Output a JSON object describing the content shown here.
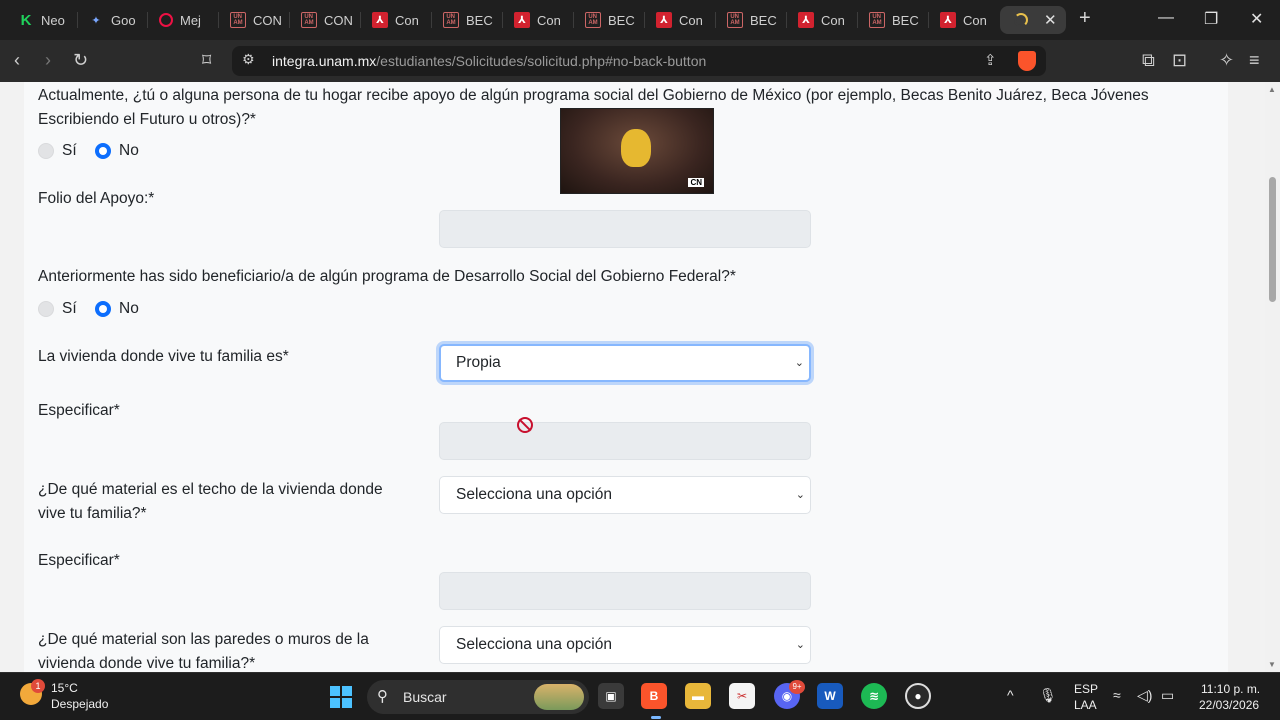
{
  "browser": {
    "tabs": [
      {
        "label": "Neo",
        "icon": "k-icon"
      },
      {
        "label": "Goo",
        "icon": "gemini-icon"
      },
      {
        "label": "Mej",
        "icon": "record-icon"
      },
      {
        "label": "CON",
        "icon": "unam-icon"
      },
      {
        "label": "CON",
        "icon": "unam-icon"
      },
      {
        "label": "Con",
        "icon": "pdf-icon"
      },
      {
        "label": "BEC",
        "icon": "unam-icon"
      },
      {
        "label": "Con",
        "icon": "pdf-icon"
      },
      {
        "label": "BEC",
        "icon": "unam-icon"
      },
      {
        "label": "Con",
        "icon": "pdf-icon"
      },
      {
        "label": "BEC",
        "icon": "unam-icon"
      },
      {
        "label": "Con",
        "icon": "pdf-icon"
      },
      {
        "label": "BEC",
        "icon": "unam-icon"
      },
      {
        "label": "Con",
        "icon": "pdf-icon"
      }
    ],
    "url_host": "integra.unam.mx",
    "url_path": "/estudiantes/Solicitudes/solicitud.php#no-back-button",
    "close_glyph": "✕",
    "new_tab_glyph": "+"
  },
  "form": {
    "q_apoyo": "Actualmente, ¿tú o alguna persona de tu hogar recibe apoyo de algún programa social del Gobierno de México (por ejemplo, Becas Benito Juárez, Beca Jóvenes Escribiendo el Futuro u otros)?*",
    "yes_label": "Sí",
    "no_label": "No",
    "folio_label": "Folio del Apoyo:*",
    "q_beneficiario": "Anteriormente has sido beneficiario/a de algún programa de Desarrollo Social del Gobierno Federal?*",
    "vivienda_label": "La vivienda donde vive tu familia es*",
    "vivienda_value": "Propia",
    "especificar_label": "Especificar*",
    "techo_label": "¿De qué material es el techo de la vivienda donde vive tu familia?*",
    "techo_value": "Selecciona una opción",
    "paredes_label": "¿De qué material son las paredes o muros de la vivienda donde vive tu familia?*",
    "paredes_value": "Selecciona una opción"
  },
  "taskbar": {
    "weather_temp": "15°C",
    "weather_desc": "Despejado",
    "weather_badge": "1",
    "search_placeholder": "Buscar",
    "discord_badge": "9+",
    "lang_1": "ESP",
    "lang_2": "LAA",
    "time": "11:10 p. m.",
    "date": "22/03/2026"
  },
  "colors": {
    "accent": "#0d6efd",
    "brave": "#fb542b",
    "pdf": "#d2222f"
  }
}
